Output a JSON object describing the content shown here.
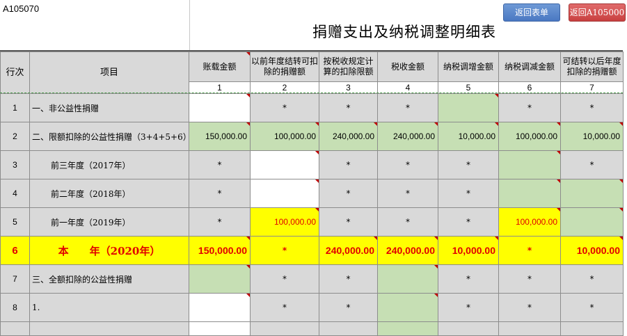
{
  "form_code": "A105070",
  "title": "捐赠支出及纳税调整明细表",
  "buttons": {
    "back_list": "返回表单",
    "back_main": "返回A105000"
  },
  "headers": {
    "row_no": "行次",
    "item": "项目",
    "col1": "账载金额",
    "col2": "以前年度结转可扣除的捐赠额",
    "col3": "按税收规定计算的扣除限额",
    "col4": "税收金额",
    "col5": "纳税调增金额",
    "col6": "纳税调减金额",
    "col7": "可结转以后年度扣除的捐赠额"
  },
  "col_numbers": [
    "1",
    "2",
    "3",
    "4",
    "5",
    "6",
    "7"
  ],
  "rows": [
    {
      "no": "1",
      "item": "一、非公益性捐赠",
      "c": [
        "",
        "*",
        "*",
        "*",
        "",
        "*",
        "*"
      ]
    },
    {
      "no": "2",
      "item": "二、限额扣除的公益性捐赠（3+4+5+6）",
      "c": [
        "150,000.00",
        "100,000.00",
        "240,000.00",
        "240,000.00",
        "10,000.00",
        "100,000.00",
        "10,000.00"
      ]
    },
    {
      "no": "3",
      "item": "前三年度（2017年）",
      "c": [
        "*",
        "",
        "*",
        "*",
        "*",
        "",
        "*"
      ]
    },
    {
      "no": "4",
      "item": "前二年度（2018年）",
      "c": [
        "*",
        "",
        "*",
        "*",
        "*",
        "",
        ""
      ]
    },
    {
      "no": "5",
      "item": "前一年度（2019年）",
      "c": [
        "*",
        "100,000.00",
        "*",
        "*",
        "*",
        "100,000.00",
        ""
      ]
    },
    {
      "no": "6",
      "item": "本　　年（2020年）",
      "c": [
        "150,000.00",
        "*",
        "240,000.00",
        "240,000.00",
        "10,000.00",
        "*",
        "10,000.00"
      ]
    },
    {
      "no": "7",
      "item": "三、全额扣除的公益性捐赠",
      "c": [
        "",
        "*",
        "*",
        "",
        "*",
        "*",
        "*"
      ]
    },
    {
      "no": "8",
      "item": "1.",
      "c": [
        "",
        "*",
        "*",
        "",
        "*",
        "*",
        "*"
      ]
    }
  ]
}
